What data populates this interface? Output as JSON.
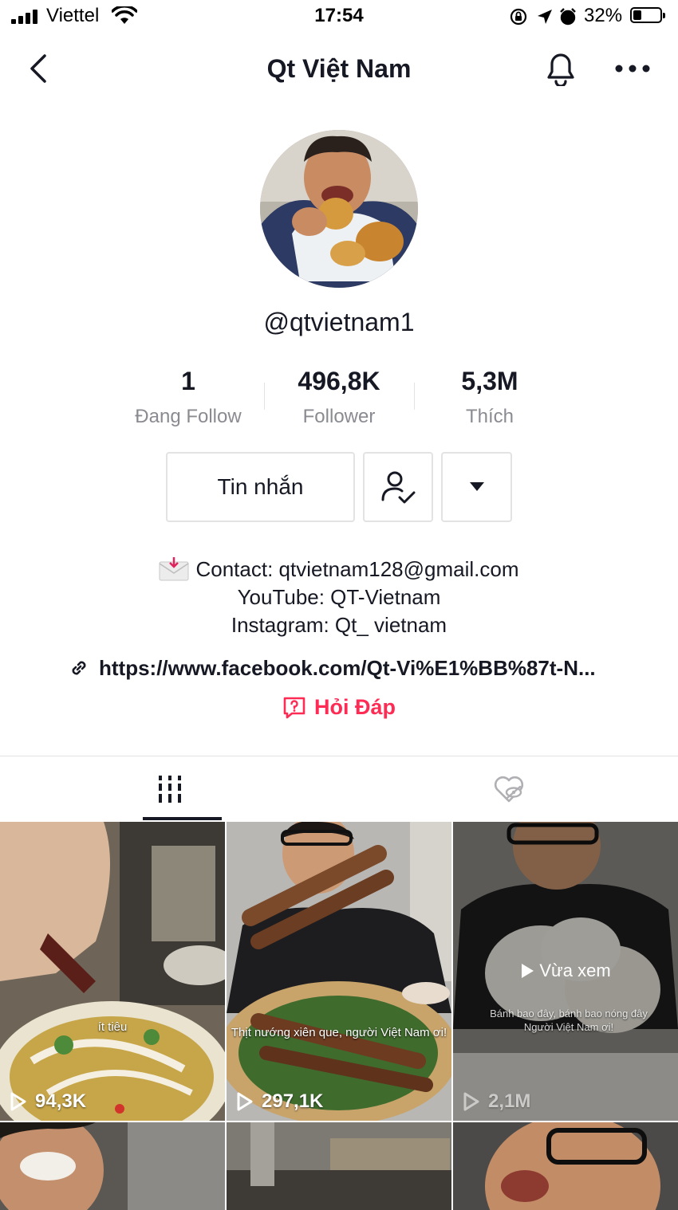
{
  "status_bar": {
    "carrier": "Viettel",
    "time": "17:54",
    "battery": "32%"
  },
  "nav": {
    "title": "Qt Việt Nam"
  },
  "profile": {
    "username": "@qtvietnam1"
  },
  "stats": [
    {
      "value": "1",
      "label": "Đang Follow"
    },
    {
      "value": "496,8K",
      "label": "Follower"
    },
    {
      "value": "5,3M",
      "label": "Thích"
    }
  ],
  "actions": {
    "message_label": "Tin nhắn"
  },
  "bio": {
    "lines": [
      "Contact: qtvietnam128@gmail.com",
      "YouTube: QT-Vietnam",
      "Instagram: Qt_ vietnam"
    ],
    "link": "https://www.facebook.com/Qt-Vi%E1%BB%87t-N...",
    "qa_label": "Hỏi Đáp"
  },
  "videos": [
    {
      "views": "94,3K",
      "caption": "ít tiêu"
    },
    {
      "views": "297,1K",
      "caption": "Thịt nướng xiên que, người Việt Nam ơi!"
    },
    {
      "views": "2,1M",
      "caption": "Bánh bao đây, bánh bao nóng đây Người Việt Nam ơi!",
      "watched_label": "Vừa xem"
    }
  ],
  "colors": {
    "accent": "#fe2c55",
    "text": "#161823",
    "muted": "#8a8b91",
    "border": "#e3e3e4"
  }
}
